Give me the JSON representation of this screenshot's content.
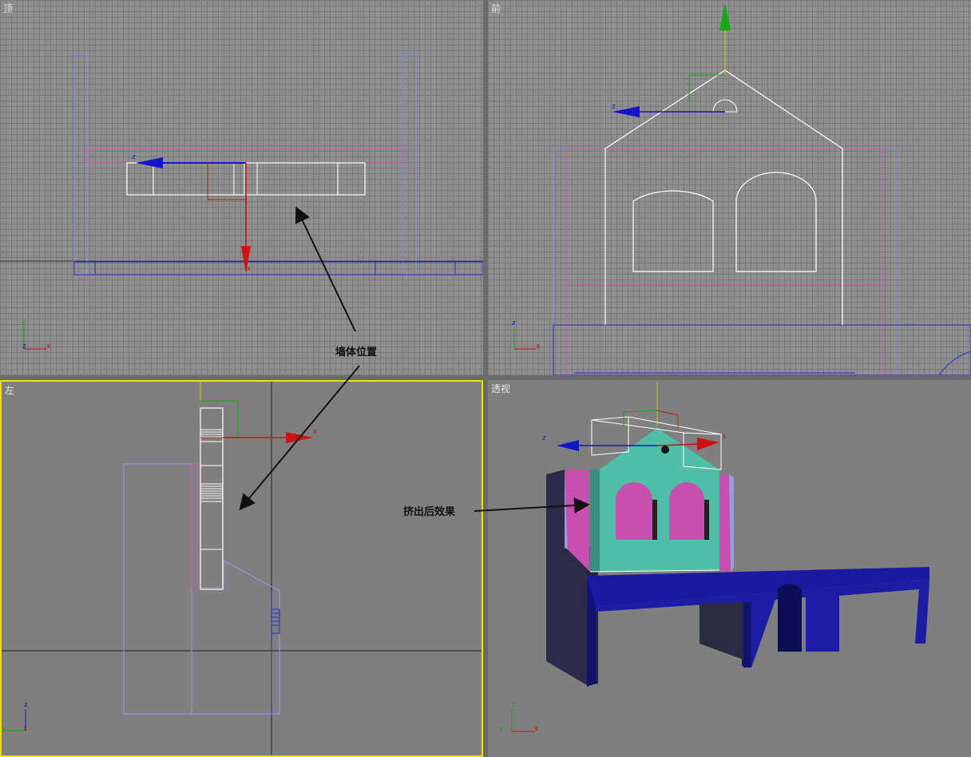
{
  "viewports": {
    "top": {
      "label": "顶"
    },
    "front": {
      "label": "前"
    },
    "left": {
      "label": "左"
    },
    "perspective": {
      "label": "透视"
    }
  },
  "axis_labels": {
    "x": "x",
    "y": "y",
    "z": "z"
  },
  "annotations": {
    "wall_position": "墙体位置",
    "after_extrude": "挤出后效果"
  },
  "colors": {
    "grid_bg": "#8f8f8f",
    "active_border": "#f0e000",
    "x_axis": "#cc0000",
    "y_axis": "#00aa00",
    "z_axis": "#0000cc",
    "wall_teal": "#4fbfa7",
    "wall_magenta": "#c64fb0",
    "base_blue": "#1a1a9a"
  }
}
